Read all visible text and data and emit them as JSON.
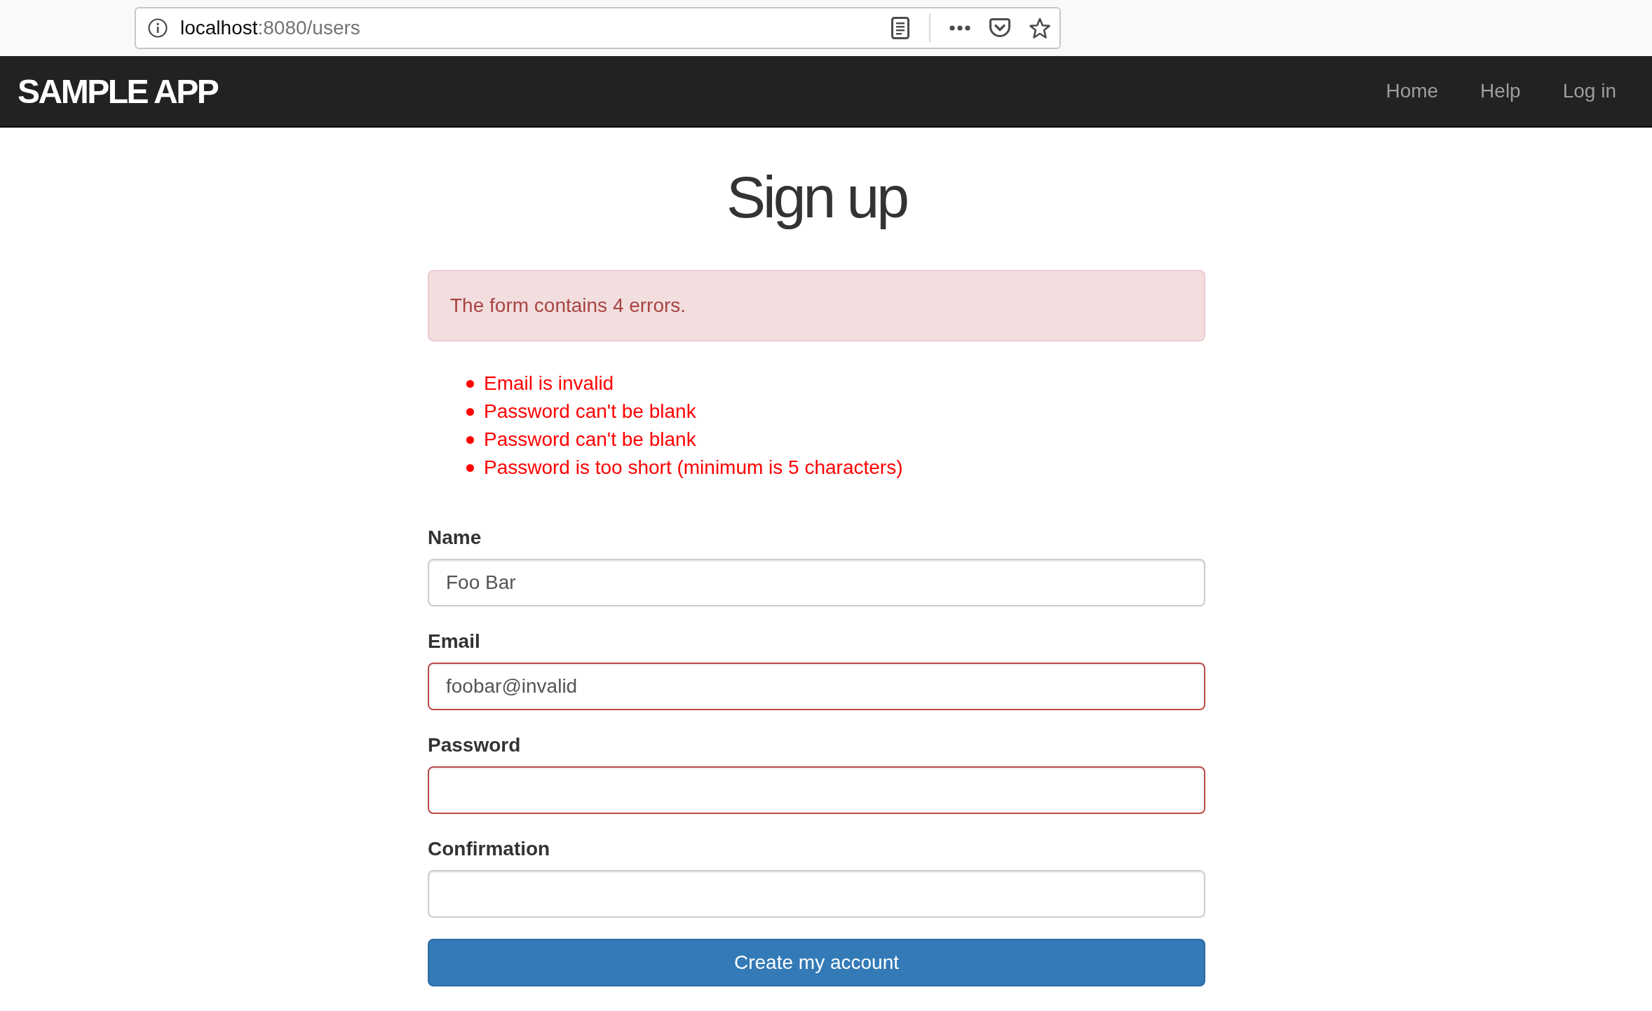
{
  "browser": {
    "url": {
      "host": "localhost",
      "path": ":8080/users"
    }
  },
  "navbar": {
    "logo": "SAMPLE APP",
    "links": [
      "Home",
      "Help",
      "Log in"
    ]
  },
  "heading": "Sign up",
  "alert": {
    "text": "The form contains 4 errors."
  },
  "errors": [
    "Email is invalid",
    "Password can't be blank",
    "Password can't be blank",
    "Password is too short (minimum is 5 characters)"
  ],
  "fields": [
    {
      "label": "Name",
      "value": "Foo Bar",
      "invalid": false
    },
    {
      "label": "Email",
      "value": "foobar@invalid",
      "invalid": true
    },
    {
      "label": "Password",
      "invalid": true
    },
    {
      "label": "Confirmation",
      "invalid": false
    }
  ],
  "submit": {
    "label": "Create my account"
  }
}
